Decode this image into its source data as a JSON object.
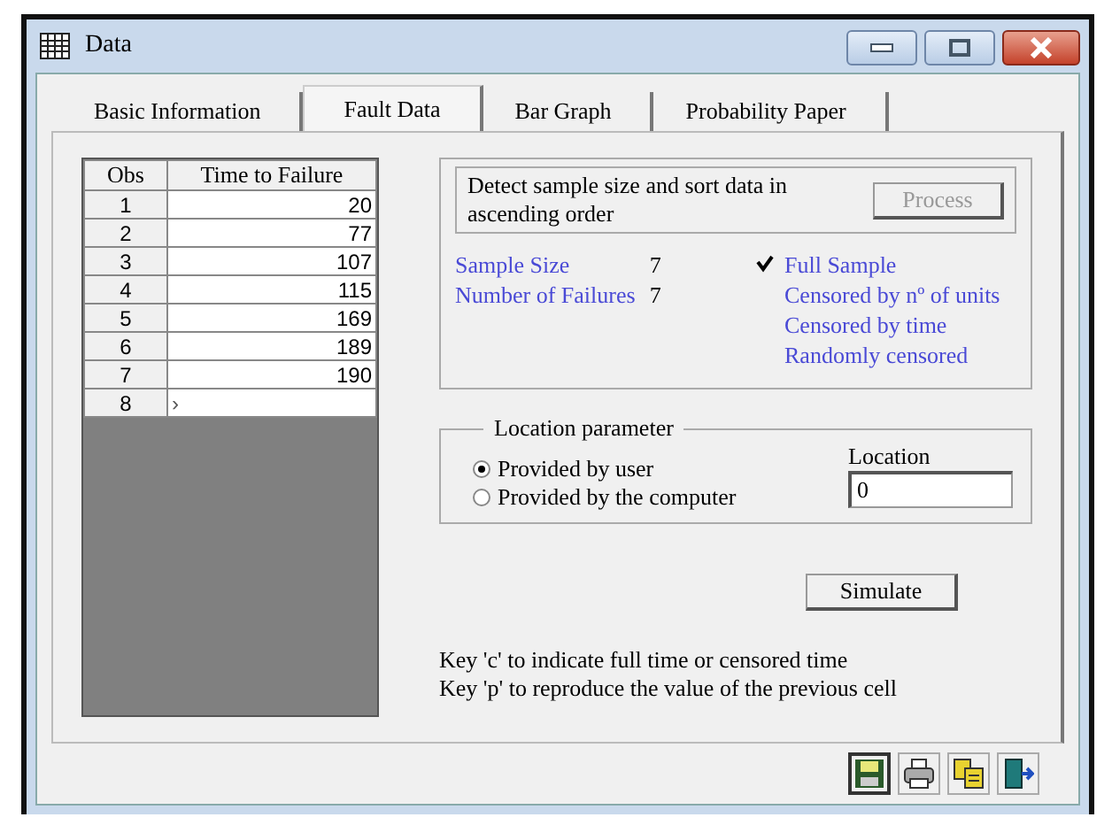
{
  "window": {
    "title": "Data"
  },
  "tabs": [
    {
      "label": "Basic Information",
      "selected": false
    },
    {
      "label": "Fault Data",
      "selected": true
    },
    {
      "label": "Bar Graph",
      "selected": false
    },
    {
      "label": "Probability Paper",
      "selected": false
    }
  ],
  "table": {
    "columns": [
      "Obs",
      "Time to Failure"
    ],
    "rows": [
      {
        "obs": "1",
        "time": "20"
      },
      {
        "obs": "2",
        "time": "77"
      },
      {
        "obs": "3",
        "time": "107"
      },
      {
        "obs": "4",
        "time": "115"
      },
      {
        "obs": "5",
        "time": "169"
      },
      {
        "obs": "6",
        "time": "189"
      },
      {
        "obs": "7",
        "time": "190"
      },
      {
        "obs": "8",
        "time": "›"
      }
    ]
  },
  "detect": {
    "text": "Detect sample size and sort data in ascending order",
    "button": {
      "label": "Process",
      "disabled": true
    }
  },
  "stats": [
    {
      "label": "Sample Size",
      "value": "7"
    },
    {
      "label": "Number of Failures",
      "value": "7"
    }
  ],
  "sample_types": [
    {
      "label": "Full Sample",
      "selected": true
    },
    {
      "label": "Censored by nº of units",
      "selected": false
    },
    {
      "label": "Censored by time",
      "selected": false
    },
    {
      "label": "Randomly censored",
      "selected": false
    }
  ],
  "location_parameter": {
    "title": "Location parameter",
    "options": [
      {
        "label": "Provided by user",
        "selected": true
      },
      {
        "label": "Provided by the computer",
        "selected": false
      }
    ],
    "field_label": "Location",
    "value": "0"
  },
  "simulate_button": "Simulate",
  "hints": [
    "Key 'c' to indicate full time or censored time",
    "Key 'p' to reproduce the value of the previous cell"
  ]
}
